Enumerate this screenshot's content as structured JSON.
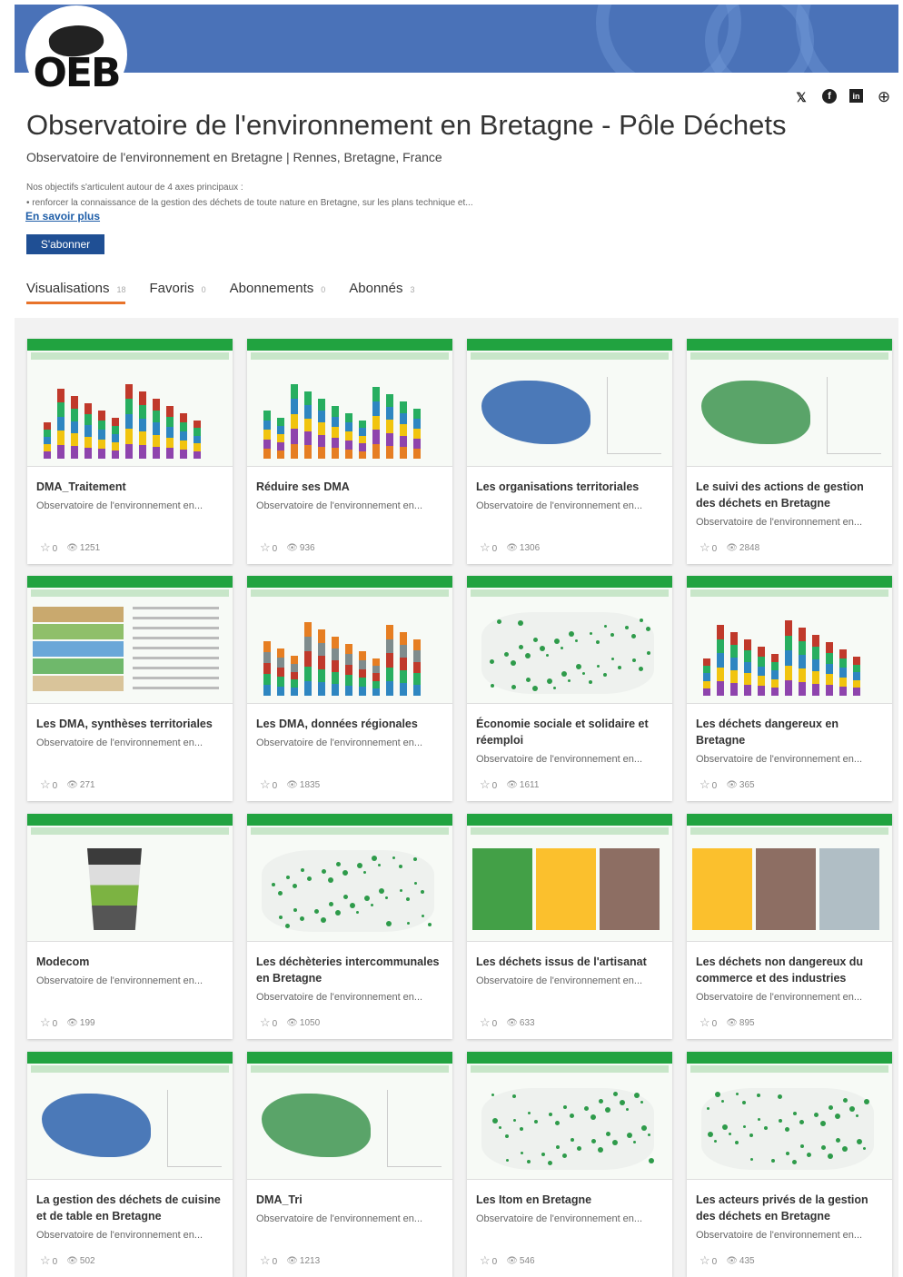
{
  "header": {
    "logo_text": "OEB",
    "title": "Observatoire de l'environnement en Bretagne - Pôle Déchets",
    "subtitle": "Observatoire de l'environnement en Bretagne | Rennes, Bretagne, France",
    "desc_line1": "Nos objectifs s'articulent autour de 4 axes principaux :",
    "desc_line2": "• renforcer la connaissance de la gestion des déchets de toute nature en Bretagne, sur les plans technique et...",
    "more_link": "En savoir plus",
    "subscribe_label": "S'abonner"
  },
  "social": {
    "twitter": "𝕏",
    "facebook": "f",
    "linkedin": "in",
    "web": "⊕"
  },
  "tabs": [
    {
      "label": "Visualisations",
      "count": "18"
    },
    {
      "label": "Favoris",
      "count": "0"
    },
    {
      "label": "Abonnements",
      "count": "0"
    },
    {
      "label": "Abonnés",
      "count": "3"
    }
  ],
  "cards": [
    {
      "title": "DMA_Traitement",
      "author": "Observatoire de l'environnement en...",
      "favs": "0",
      "views": "1251",
      "kind": "bars"
    },
    {
      "title": "Réduire ses DMA",
      "author": "Observatoire de l'environnement en...",
      "favs": "0",
      "views": "936",
      "kind": "bars"
    },
    {
      "title": "Les organisations territoriales",
      "author": "Observatoire de l'environnement en...",
      "favs": "0",
      "views": "1306",
      "kind": "map"
    },
    {
      "title": "Le suivi des actions de gestion des déchets en Bretagne",
      "author": "Observatoire de l'environnement en...",
      "favs": "0",
      "views": "2848",
      "kind": "map"
    },
    {
      "title": "Les DMA, synthèses territoriales",
      "author": "Observatoire de l'environnement en...",
      "favs": "0",
      "views": "271",
      "kind": "table"
    },
    {
      "title": "Les DMA, données régionales",
      "author": "Observatoire de l'environnement en...",
      "favs": "0",
      "views": "1835",
      "kind": "bars"
    },
    {
      "title": "Économie sociale et solidaire et réemploi",
      "author": "Observatoire de l'environnement en...",
      "favs": "0",
      "views": "1611",
      "kind": "dots"
    },
    {
      "title": "Les déchets dangereux en Bretagne",
      "author": "Observatoire de l'environnement en...",
      "favs": "0",
      "views": "365",
      "kind": "bars"
    },
    {
      "title": "Modecom",
      "author": "Observatoire de l'environnement en...",
      "favs": "0",
      "views": "199",
      "kind": "bin"
    },
    {
      "title": "Les déchèteries intercommunales en Bretagne",
      "author": "Observatoire de l'environnement en...",
      "favs": "0",
      "views": "1050",
      "kind": "dots"
    },
    {
      "title": "Les déchets issus de l'artisanat",
      "author": "Observatoire de l'environnement en...",
      "favs": "0",
      "views": "633",
      "kind": "tree"
    },
    {
      "title": "Les déchets non dangereux du commerce et des industries",
      "author": "Observatoire de l'environnement en...",
      "favs": "0",
      "views": "895",
      "kind": "tree"
    },
    {
      "title": "La gestion des déchets de cuisine et de table en Bretagne",
      "author": "Observatoire de l'environnement en...",
      "favs": "0",
      "views": "502",
      "kind": "map"
    },
    {
      "title": "DMA_Tri",
      "author": "Observatoire de l'environnement en...",
      "favs": "0",
      "views": "1213",
      "kind": "map"
    },
    {
      "title": "Les Itom en Bretagne",
      "author": "Observatoire de l'environnement en...",
      "favs": "0",
      "views": "546",
      "kind": "dots"
    },
    {
      "title": "Les acteurs privés de la gestion des déchets en Bretagne",
      "author": "Observatoire de l'environnement en...",
      "favs": "0",
      "views": "435",
      "kind": "dots"
    }
  ]
}
